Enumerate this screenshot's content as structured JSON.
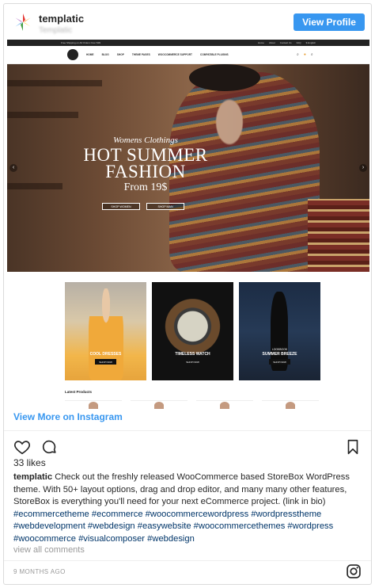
{
  "header": {
    "account_name": "templatic",
    "account_subtitle": "Templatic",
    "view_profile_label": "View Profile"
  },
  "post_image": {
    "topbar_left": [
      "Free Shipping on All Orders Over $99"
    ],
    "topbar_right": [
      "Home",
      "About",
      "Contact Us",
      "FAQ",
      "$ English"
    ],
    "nav_menu": [
      "HOME",
      "BLOG",
      "SHOP",
      "THEME PAGES",
      "WOOCOMMERCE SUPPORT",
      "COMPATIBLE PLUGINS"
    ],
    "nav_tools": [
      "⌕",
      "●",
      "⌕"
    ],
    "hero": {
      "kicker": "Womens Clothings",
      "title": "HOT SUMMER FASHION",
      "price": "From 19$",
      "buttons": [
        "SHOP WOMEN",
        "SHOP MAN"
      ],
      "prev_arrow": "‹",
      "next_arrow": "›"
    },
    "tiles": [
      {
        "kicker": "",
        "title": "COOL DRESSES",
        "button": "SHOP NOW"
      },
      {
        "kicker": "",
        "title": "TIMELESS WATCH",
        "button": "SHOP NOW"
      },
      {
        "kicker": "LOOKBOOK",
        "title": "SUMMER BREEZE",
        "button": "SHOP NOW"
      }
    ],
    "latest_products_label": "Latest Products"
  },
  "view_more": "View More on Instagram",
  "likes": "33 likes",
  "caption": {
    "username": "templatic",
    "text": "Check out the freshly released WooCommerce based StoreBox WordPress theme. With 50+ layout options, drag and drop editor, and many many other features, StoreBox is everything you'll need for your next eCommerce project. (link in bio)",
    "hashtags": [
      "#ecommercetheme",
      "#ecommerce",
      "#woocommercewordpress",
      "#wordpresstheme",
      "#webdevelopment",
      "#webdesign",
      "#easywebsite",
      "#woocommercethemes",
      "#wordpress",
      "#woocommerce",
      "#visualcomposer",
      "#webdesign"
    ]
  },
  "view_all_comments": "view all comments",
  "timestamp": "9 MONTHS AGO",
  "colors": {
    "accent": "#3897f0",
    "hashtag": "#003569",
    "muted": "#999999"
  },
  "icons": [
    "templatic-logo-icon",
    "heart-icon",
    "comment-icon",
    "bookmark-icon",
    "instagram-icon"
  ]
}
